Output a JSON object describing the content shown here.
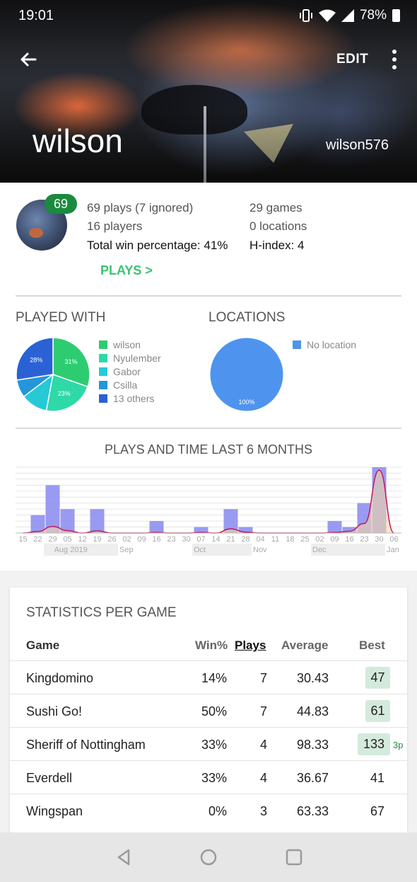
{
  "status_bar": {
    "time": "19:01",
    "battery": "78%"
  },
  "header": {
    "edit_label": "EDIT",
    "name": "wilson",
    "username": "wilson576"
  },
  "summary": {
    "badge": "69",
    "plays": "69 plays (7 ignored)",
    "games": "29 games",
    "players": "16 players",
    "locations": "0 locations",
    "win_pct": "Total win percentage: 41%",
    "h_index": "H-index: 4",
    "plays_link": "PLAYS >"
  },
  "played_with": {
    "title": "PLAYED WITH",
    "legend": [
      {
        "name": "wilson",
        "color": "#2ecc71"
      },
      {
        "name": "Nyulember",
        "color": "#2ed9a8"
      },
      {
        "name": "Gabor",
        "color": "#26c9d6"
      },
      {
        "name": "Csilla",
        "color": "#2496d9"
      },
      {
        "name": "13 others",
        "color": "#2a62d6"
      }
    ]
  },
  "locations": {
    "title": "LOCATIONS",
    "legend": [
      {
        "name": "No location",
        "color": "#4e94ee"
      }
    ]
  },
  "activity": {
    "title": "PLAYS AND TIME LAST 6 MONTHS"
  },
  "stats": {
    "title": "STATISTICS PER GAME",
    "headers": {
      "game": "Game",
      "win": "Win%",
      "plays": "Plays",
      "average": "Average",
      "best": "Best"
    },
    "rows": [
      {
        "game": "Kingdomino",
        "win": "14%",
        "plays": "7",
        "average": "30.43",
        "best": "47",
        "note": ""
      },
      {
        "game": "Sushi Go!",
        "win": "50%",
        "plays": "7",
        "average": "44.83",
        "best": "61",
        "note": ""
      },
      {
        "game": "Sheriff of Nottingham",
        "win": "33%",
        "plays": "4",
        "average": "98.33",
        "best": "133",
        "note": "3p"
      },
      {
        "game": "Everdell",
        "win": "33%",
        "plays": "4",
        "average": "36.67",
        "best": "41",
        "note": ""
      },
      {
        "game": "Wingspan",
        "win": "0%",
        "plays": "3",
        "average": "63.33",
        "best": "67",
        "note": ""
      }
    ]
  },
  "chart_data": [
    {
      "type": "pie",
      "categories": [
        "wilson",
        "Nyulember",
        "Gabor",
        "Csilla",
        "13 others"
      ],
      "values": [
        31,
        23,
        12,
        8,
        28
      ],
      "data_labels": [
        "31%",
        "23%",
        "",
        "",
        "28%"
      ]
    },
    {
      "type": "pie",
      "categories": [
        "No location"
      ],
      "values": [
        100
      ],
      "data_labels": [
        "100%"
      ]
    },
    {
      "type": "bar",
      "title": "PLAYS AND TIME LAST 6 MONTHS",
      "categories": [
        "15",
        "22",
        "29",
        "05",
        "12",
        "19",
        "26",
        "02",
        "09",
        "16",
        "23",
        "30",
        "07",
        "14",
        "21",
        "28",
        "04",
        "11",
        "18",
        "25",
        "02",
        "09",
        "16",
        "23",
        "30",
        "06"
      ],
      "values": [
        0,
        3,
        8,
        4,
        0,
        4,
        0,
        0,
        0,
        2,
        0,
        0,
        1,
        0,
        4,
        1,
        0,
        0,
        0,
        0,
        0,
        2,
        1,
        5,
        11,
        0
      ],
      "month_labels": [
        "Aug 2019",
        "Sep",
        "Oct",
        "Nov",
        "Dec",
        "Jan"
      ],
      "month_label_weeks": [
        2,
        7,
        12,
        16,
        20,
        25
      ],
      "month_shaded_spans": [
        [
          2,
          6
        ],
        [
          12,
          15
        ],
        [
          20,
          24
        ]
      ],
      "time_line": [
        0,
        0.25,
        1.1,
        0.4,
        0,
        0.35,
        0,
        0,
        0,
        0.1,
        0,
        0,
        0.1,
        0,
        0.7,
        0.15,
        0,
        0,
        0,
        0,
        0,
        0.1,
        0.3,
        1.6,
        10.5,
        0
      ],
      "ylim": [
        0,
        11
      ]
    }
  ]
}
